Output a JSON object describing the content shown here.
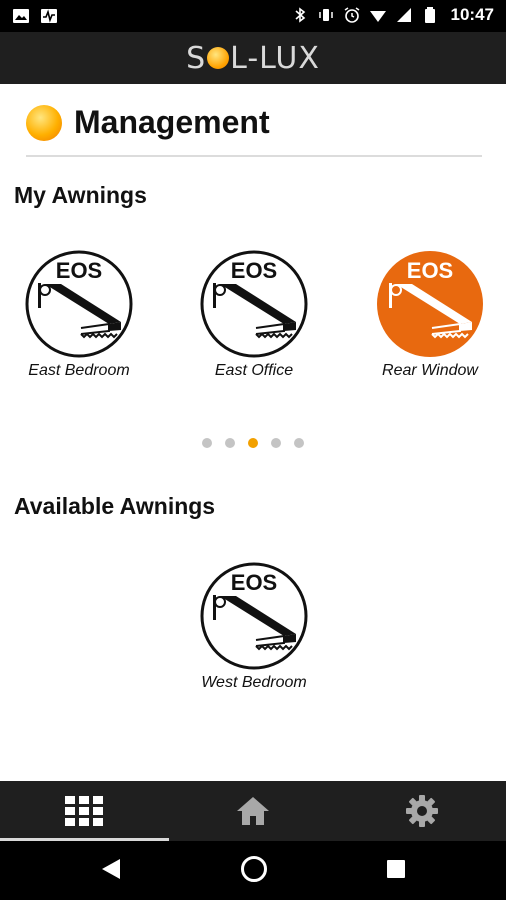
{
  "status_bar": {
    "time": "10:47",
    "left_icons": [
      "image-icon",
      "activity-icon"
    ],
    "right_icons": [
      "bluetooth-icon",
      "vibrate-icon",
      "alarm-icon",
      "wifi-icon",
      "signal-icon",
      "battery-icon"
    ]
  },
  "app_bar": {
    "logo_left": "S",
    "logo_right": "L-LUX"
  },
  "header": {
    "title": "Management",
    "icon": "sun-icon"
  },
  "my_awnings": {
    "title": "My Awnings",
    "items": [
      {
        "brand": "EOS",
        "name": "East Bedroom",
        "selected": false
      },
      {
        "brand": "EOS",
        "name": "East Office",
        "selected": false
      },
      {
        "brand": "EOS",
        "name": "Rear Window",
        "selected": true
      }
    ],
    "pager": {
      "count": 5,
      "active_index": 2
    }
  },
  "available_awnings": {
    "title": "Available Awnings",
    "items": [
      {
        "brand": "EOS",
        "name": "West Bedroom",
        "selected": false
      }
    ]
  },
  "tab_bar": {
    "tabs": [
      {
        "icon": "grid-icon",
        "active": true
      },
      {
        "icon": "home-icon",
        "active": false
      },
      {
        "icon": "gear-icon",
        "active": false
      }
    ]
  },
  "nav_bar": {
    "buttons": [
      "back-icon",
      "home-circle-icon",
      "recents-icon"
    ]
  },
  "colors": {
    "accent_orange": "#e8690f",
    "dot_active": "#f2a000",
    "dark_bar": "#1f1f1f"
  }
}
